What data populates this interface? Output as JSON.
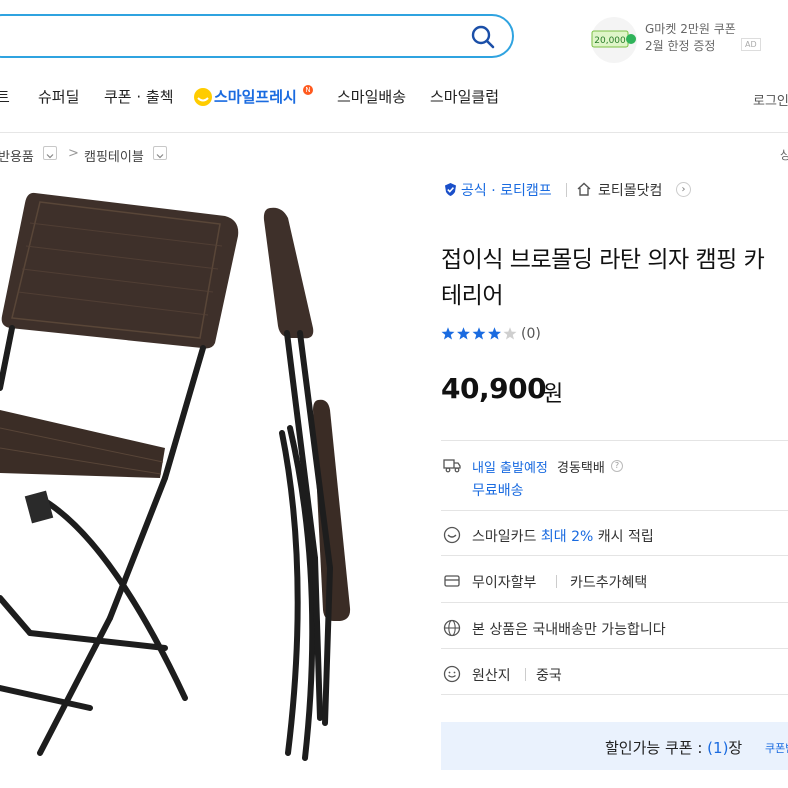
{
  "header": {
    "promo": {
      "badge_amount": "20,000",
      "line1": "G마켓 2만원 쿠폰",
      "line2": "2월 한정 증정",
      "ad": "AD"
    }
  },
  "nav": {
    "items": [
      "트",
      "슈퍼딜",
      "쿠폰 · 출첵",
      "스마일프레시",
      "스마일배송",
      "스마일클럽"
    ],
    "fresh_badge": "N",
    "login": "로그인"
  },
  "breadcrumb": {
    "items": [
      "반용품",
      "캠핑테이블"
    ],
    "separator": ">",
    "right": "상"
  },
  "seller": {
    "badge": "공식 · 로티캠프",
    "store_name": "로티몰닷컴"
  },
  "product": {
    "title_line1": "접이식 브로몰딩 라탄 의자 캠핑 카",
    "title_line2": "테리어",
    "rating": 4,
    "rating_max": 5,
    "review_count": "(0)",
    "price": "40,900",
    "price_unit": "원"
  },
  "shipping": {
    "departure": "내일 출발예정",
    "carrier": "경동택배",
    "help": "?",
    "fee": "무료배송"
  },
  "benefits": {
    "smile_card_prefix": "스마일카드",
    "smile_card_highlight": "최대 2%",
    "smile_card_suffix": "캐시 적립",
    "installment": "무이자할부",
    "card_benefit": "카드추가혜택",
    "domestic_only": "본 상품은 국내배송만 가능합니다",
    "origin_label": "원산지",
    "origin_value": "중국"
  },
  "coupon": {
    "label": "할인가능 쿠폰 :",
    "count": "(1)",
    "unit": "장",
    "link": "쿠폰받기"
  },
  "colors": {
    "accent_blue": "#1a6be0",
    "search_border": "#2fa3e0",
    "fresh_yellow": "#ffcc00",
    "coupon_bg": "#eaf2fd"
  },
  "icons": [
    "search-icon",
    "shield-check-icon",
    "home-icon",
    "chevron-right-icon",
    "truck-icon",
    "smile-card-icon",
    "card-icon",
    "globe-icon",
    "smile-icon",
    "star-icon"
  ]
}
